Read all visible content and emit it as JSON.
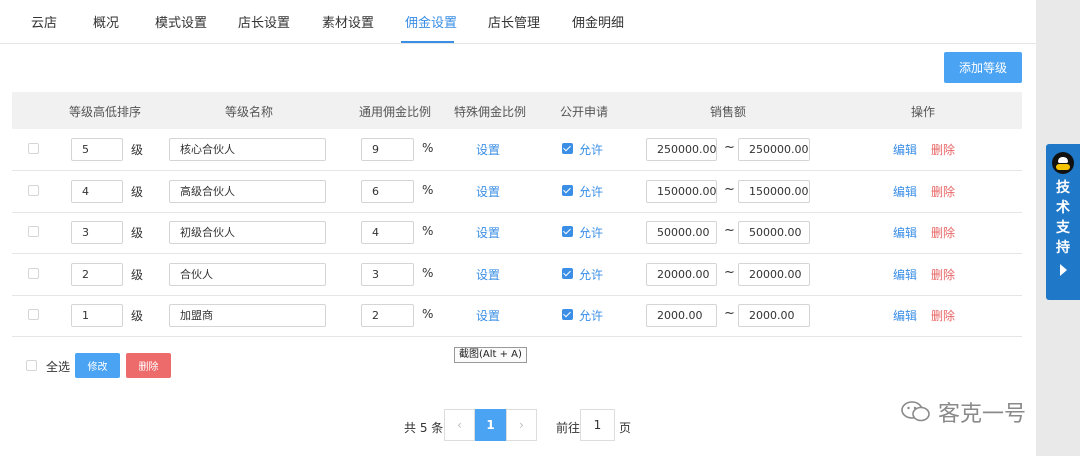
{
  "nav": {
    "tabs": [
      "云店",
      "概况",
      "模式设置",
      "店长设置",
      "素材设置",
      "佣金设置",
      "店长管理",
      "佣金明细"
    ],
    "active": 5
  },
  "toolbar": {
    "add_label": "添加等级"
  },
  "table": {
    "headers": [
      "等级高低排序",
      "等级名称",
      "通用佣金比例",
      "特殊佣金比例",
      "公开申请",
      "销售额",
      "操作"
    ],
    "level_unit": "级",
    "percent_unit": "%",
    "special_link": "设置",
    "apply_label": "允许",
    "range_sep": "~",
    "edit_label": "编辑",
    "delete_label": "删除",
    "rows": [
      {
        "rank": "5",
        "name": "核心合伙人",
        "rate": "9",
        "sales_min": "250000.00",
        "sales_max": "250000.00"
      },
      {
        "rank": "4",
        "name": "高级合伙人",
        "rate": "6",
        "sales_min": "150000.00",
        "sales_max": "150000.00"
      },
      {
        "rank": "3",
        "name": "初级合伙人",
        "rate": "4",
        "sales_min": "50000.00",
        "sales_max": "50000.00"
      },
      {
        "rank": "2",
        "name": "合伙人",
        "rate": "3",
        "sales_min": "20000.00",
        "sales_max": "20000.00"
      },
      {
        "rank": "1",
        "name": "加盟商",
        "rate": "2",
        "sales_min": "2000.00",
        "sales_max": "2000.00"
      }
    ]
  },
  "bulk": {
    "select_all": "全选",
    "edit": "修改",
    "delete": "删除"
  },
  "tooltip": "截图(Alt + A)",
  "pager": {
    "total": "共 5 条",
    "prev": "‹",
    "current": "1",
    "next": "›",
    "goto": "前往",
    "goto_value": "1",
    "page_unit": "页"
  },
  "support": {
    "label": "技术支持"
  },
  "watermark": "客克一号"
}
